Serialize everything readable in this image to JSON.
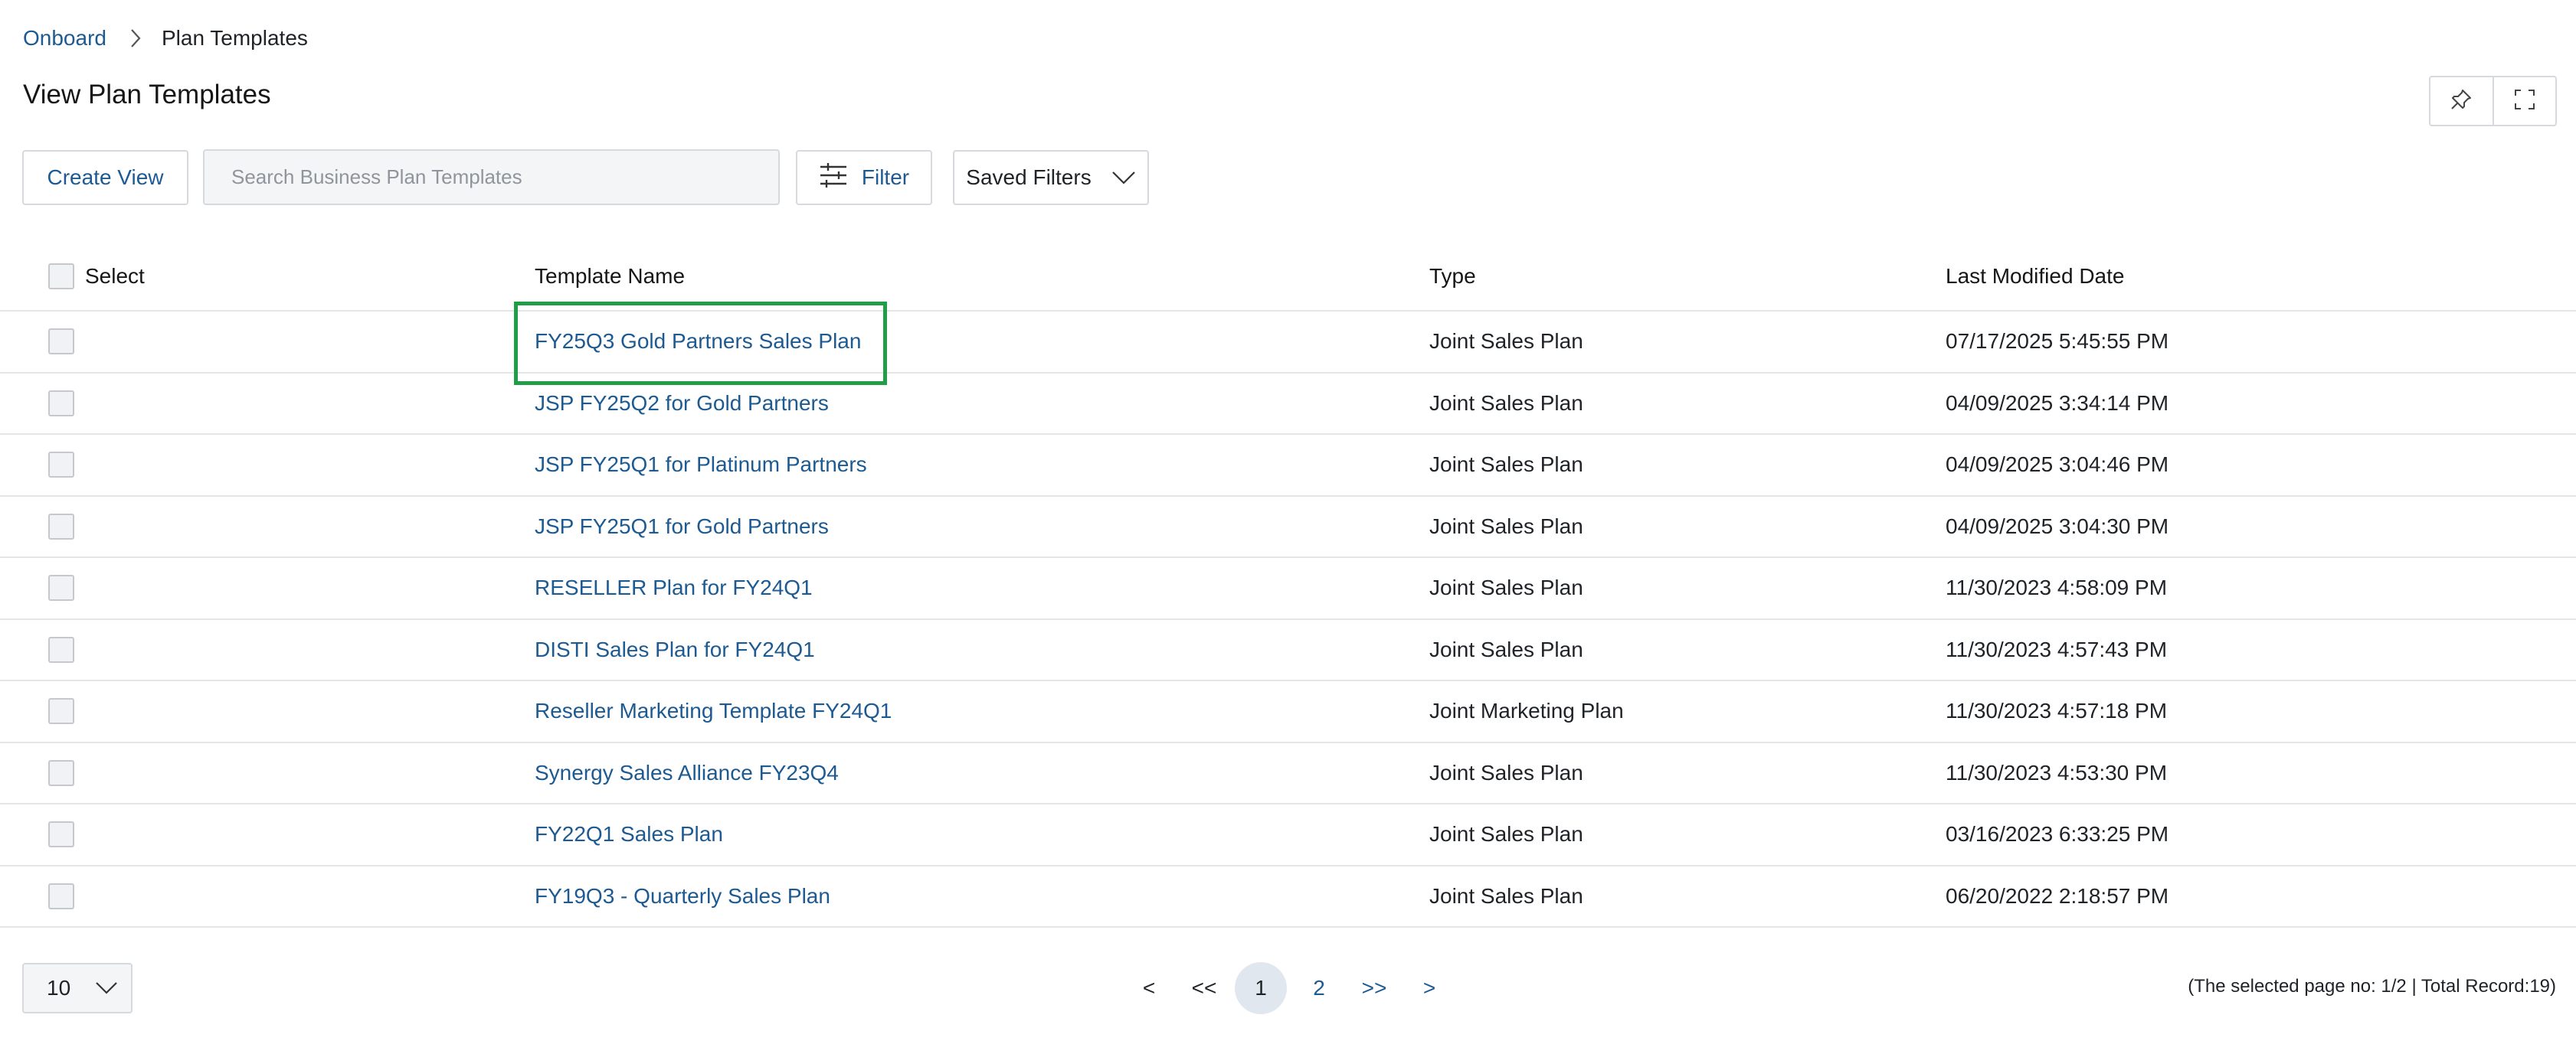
{
  "breadcrumb": {
    "root": "Onboard",
    "current": "Plan Templates"
  },
  "page_title": "View Plan Templates",
  "toolbar": {
    "create_view_label": "Create View",
    "search_placeholder": "Search Business Plan Templates",
    "filter_label": "Filter",
    "saved_filters_label": "Saved Filters"
  },
  "table": {
    "headers": {
      "select": "Select",
      "name": "Template Name",
      "type": "Type",
      "date": "Last Modified Date"
    },
    "rows": [
      {
        "name": "FY25Q3 Gold Partners Sales Plan",
        "type": "Joint Sales Plan",
        "date": "07/17/2025 5:45:55 PM"
      },
      {
        "name": "JSP FY25Q2 for Gold Partners",
        "type": "Joint Sales Plan",
        "date": "04/09/2025 3:34:14 PM"
      },
      {
        "name": "JSP FY25Q1 for Platinum Partners",
        "type": "Joint Sales Plan",
        "date": "04/09/2025 3:04:46 PM"
      },
      {
        "name": "JSP FY25Q1 for Gold Partners",
        "type": "Joint Sales Plan",
        "date": "04/09/2025 3:04:30 PM"
      },
      {
        "name": "RESELLER Plan for FY24Q1",
        "type": "Joint Sales Plan",
        "date": "11/30/2023 4:58:09 PM"
      },
      {
        "name": "DISTI Sales Plan for FY24Q1",
        "type": "Joint Sales Plan",
        "date": "11/30/2023 4:57:43 PM"
      },
      {
        "name": "Reseller Marketing Template FY24Q1",
        "type": "Joint Marketing Plan",
        "date": "11/30/2023 4:57:18 PM"
      },
      {
        "name": "Synergy Sales Alliance FY23Q4",
        "type": "Joint Sales Plan",
        "date": "11/30/2023 4:53:30 PM"
      },
      {
        "name": "FY22Q1 Sales Plan",
        "type": "Joint Sales Plan",
        "date": "03/16/2023 6:33:25 PM"
      },
      {
        "name": "FY19Q3 - Quarterly Sales Plan",
        "type": "Joint Sales Plan",
        "date": "06/20/2022 2:18:57 PM"
      }
    ]
  },
  "pagination": {
    "page_size": "10",
    "prev": "<",
    "first": "<<",
    "page1": "1",
    "page2": "2",
    "last": ">>",
    "next": ">",
    "info": "(The selected page no: 1/2 | Total Record:19)"
  },
  "colors": {
    "link": "#1d5a92",
    "highlight": "#1f9e47",
    "active_page_bg": "#e1e7ef"
  }
}
